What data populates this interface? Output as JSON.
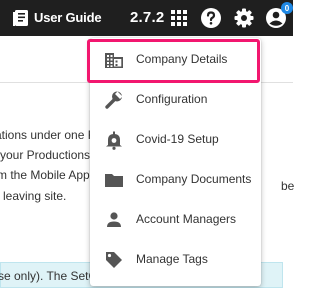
{
  "topbar": {
    "guide_label": "User Guide",
    "version": "2.7.2",
    "notification_count": "0",
    "icons": [
      "book-icon",
      "apps-grid-icon",
      "help-icon",
      "gear-icon",
      "account-icon"
    ]
  },
  "background": {
    "lines": [
      "ations under one F",
      "your Productions",
      "m the Mobile App",
      "leaving site.",
      "be"
    ],
    "notice": "se only). The SetC"
  },
  "menu": {
    "items": [
      {
        "label": "Company Details",
        "icon": "company-building-icon"
      },
      {
        "label": "Configuration",
        "icon": "wrench-icon"
      },
      {
        "label": "Covid-19 Setup",
        "icon": "covid-bell-icon"
      },
      {
        "label": "Company Documents",
        "icon": "folder-icon"
      },
      {
        "label": "Account Managers",
        "icon": "person-icon"
      },
      {
        "label": "Manage Tags",
        "icon": "tag-icon"
      }
    ]
  },
  "colors": {
    "topbar": "#1f1f1f",
    "highlight": "#f2176f",
    "badge": "#1e88e5",
    "menu_icon": "#555555",
    "notice_bg": "#dff3f7"
  }
}
